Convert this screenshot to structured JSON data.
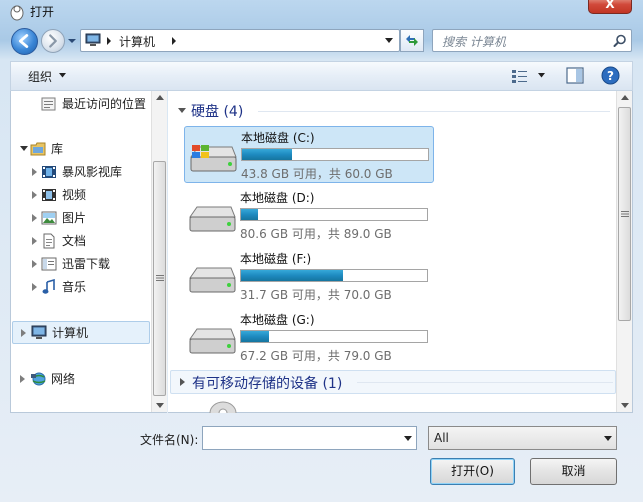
{
  "window": {
    "title": "打开",
    "close_glyph": "X"
  },
  "address": {
    "segment": "计算机"
  },
  "search": {
    "placeholder": "搜索 计算机"
  },
  "toolbar": {
    "organize_label": "组织"
  },
  "nav": {
    "recent": "最近访问的位置",
    "libraries": "库",
    "lib_items": [
      "暴风影视库",
      "视频",
      "图片",
      "文档",
      "迅雷下载",
      "音乐"
    ],
    "computer": "计算机",
    "network": "网络"
  },
  "groups": {
    "hard_disks": "硬盘 (4)",
    "removable": "有可移动存储的设备 (1)"
  },
  "drives": [
    {
      "name": "本地磁盘 (C:)",
      "free": "43.8 GB 可用，共 60.0 GB",
      "used_fraction": 0.27
    },
    {
      "name": "本地磁盘 (D:)",
      "free": "80.6 GB 可用，共 89.0 GB",
      "used_fraction": 0.09
    },
    {
      "name": "本地磁盘 (F:)",
      "free": "31.7 GB 可用，共 70.0 GB",
      "used_fraction": 0.55
    },
    {
      "name": "本地磁盘 (G:)",
      "free": "67.2 GB 可用，共 79.0 GB",
      "used_fraction": 0.15
    }
  ],
  "bottom": {
    "filename_label": "文件名(N):",
    "filename_value": "",
    "filter_value": "All",
    "open_label": "打开(O)",
    "cancel_label": "取消"
  },
  "colors": {
    "accent": "#1e8ac0",
    "group_header": "#1e3287",
    "selection": "#cde6f7"
  }
}
